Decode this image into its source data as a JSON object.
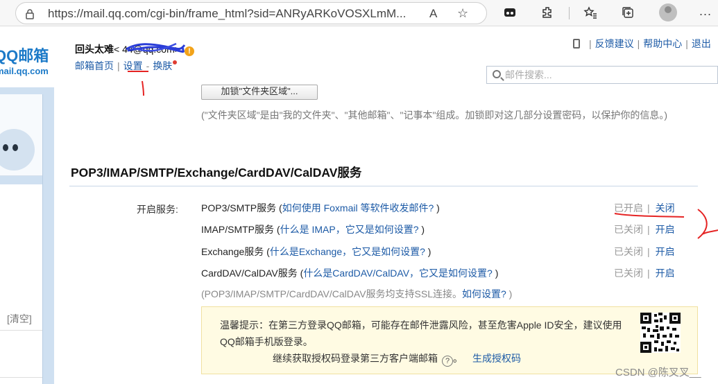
{
  "browser": {
    "url": "https://mail.qq.com/cgi-bin/frame_html?sid=ANRyARKoVOSXLmM...",
    "read_aloud_glyph": "A",
    "more_glyph": "..."
  },
  "header": {
    "logo_main": "QQ邮箱",
    "logo_sub": "mail.qq.com",
    "user_name": "回头太难",
    "user_email_visible": "<        44@qq.com>",
    "warn_glyph": "!",
    "nav": {
      "home": "邮箱首页",
      "sep1": "|",
      "settings": "设置",
      "sep2": "-",
      "skin": "换肤"
    },
    "top_links": {
      "sep1": "|",
      "feedback": "反馈建议",
      "sep2": "|",
      "help_center": "帮助中心",
      "sep3": "|",
      "logout": "退出"
    },
    "search_placeholder": "邮件搜索..."
  },
  "left_panel": {
    "clear_link": "[清空]"
  },
  "main": {
    "folder_button_label": "加锁\"文件夹区域\"...",
    "folder_note": "(\"文件夹区域\"是由\"我的文件夹\"、\"其他邮箱\"、\"记事本\"组成。加锁即对这几部分设置密码，以保护你的信息。)",
    "section_title": "POP3/IMAP/SMTP/Exchange/CardDAV/CalDAV服务",
    "service_label": "开启服务:",
    "services": [
      {
        "name": "POP3/SMTP服务",
        "open": " (",
        "help": "如何使用 Foxmail 等软件收发邮件?",
        "close": " )",
        "status": "已开启",
        "sep": "|",
        "action": "关闭"
      },
      {
        "name": "IMAP/SMTP服务",
        "open": " (",
        "help": "什么是 IMAP，它又是如何设置?",
        "close": " )",
        "status": "已关闭",
        "sep": "|",
        "action": "开启"
      },
      {
        "name": "Exchange服务",
        "open": " (",
        "help": "什么是Exchange，它又是如何设置?",
        "close": " )",
        "status": "已关闭",
        "sep": "|",
        "action": "开启"
      },
      {
        "name": "CardDAV/CalDAV服务",
        "open": " (",
        "help": "什么是CardDAV/CalDAV，它又是如何设置?",
        "close": " )",
        "status": "已关闭",
        "sep": "|",
        "action": "开启"
      }
    ],
    "ssl_note_prefix": "(POP3/IMAP/SMTP/CardDAV/CalDAV服务均支持SSL连接。",
    "ssl_note_link": "如何设置?",
    "ssl_note_suffix": " )",
    "tip_text": "温馨提示：在第三方登录QQ邮箱，可能存在邮件泄露风险，甚至危害Apple ID安全，建议使用QQ邮箱手机版登录。",
    "tip_action_text": "继续获取授权码登录第三方客户端邮箱",
    "tip_q_glyph": "?",
    "tip_action_end": "。",
    "generate_code_link": "生成授权码"
  },
  "watermark": "CSDN @陈叉叉__",
  "colors": {
    "link": "#1c5aa6",
    "band": "#cfe0f1",
    "annotation_red": "#e52323",
    "annotation_blue": "#2a3dd8"
  }
}
